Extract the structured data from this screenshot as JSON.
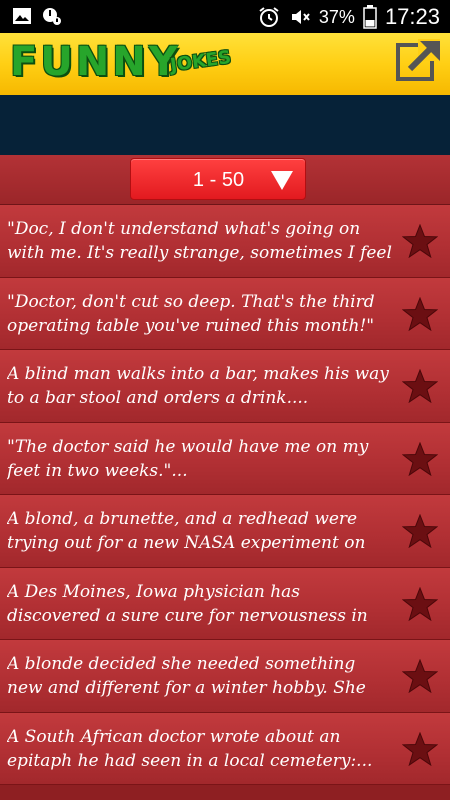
{
  "status_bar": {
    "battery": "37%",
    "time": "17:23"
  },
  "header": {
    "logo_main": "FUNNY",
    "logo_sub": "JOKES"
  },
  "range_selector": {
    "value": "1 - 50"
  },
  "jokes": [
    {
      "text": "\"Doc, I don't understand what's going on with me. It's really strange, sometimes I feel like a..."
    },
    {
      "text": "\"Doctor, don't cut so deep. That's the third operating table you've ruined this month!\""
    },
    {
      "text": "A blind man walks into a bar, makes his way to a bar stool and orders a drink...."
    },
    {
      "text": "\"The doctor said he would have me on my feet in two weeks.\"..."
    },
    {
      "text": "A blond, a brunette, and a redhead were trying out for a new NASA experiment on sending..."
    },
    {
      "text": "A Des Moines, Iowa physician has discovered a sure cure for nervousness in women. He tells..."
    },
    {
      "text": "A blonde decided she needed something new and different for a winter hobby. She went to t..."
    },
    {
      "text": "A South African doctor wrote about an epitaph he had seen in a local cemetery:..."
    }
  ],
  "colors": {
    "header_yellow": "#ffcf14",
    "logo_green": "#27a52b",
    "banner_navy": "#062238",
    "item_red": "#b02f33",
    "star_dark": "#6b0f12"
  }
}
